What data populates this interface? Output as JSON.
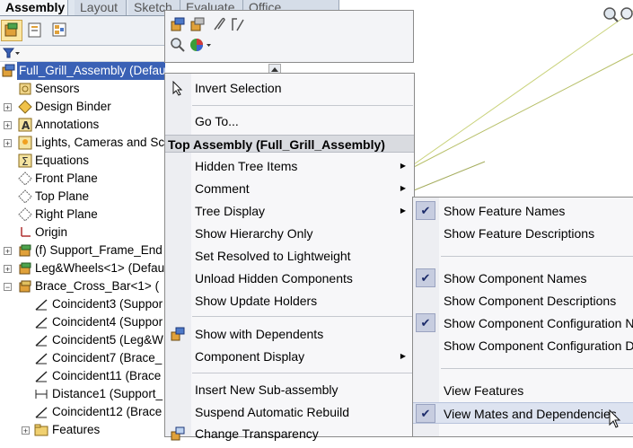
{
  "tabs": [
    "Assembly",
    "Layout",
    "Sketch",
    "Evaluate",
    "Office Products"
  ],
  "tree": {
    "root": "Full_Grill_Assembly  (Default<Full_Display_State",
    "items": [
      {
        "label": "Sensors",
        "icon": "sensors-icon",
        "expandable": false
      },
      {
        "label": "Design Binder",
        "icon": "design-binder-icon",
        "expandable": true
      },
      {
        "label": "Annotations",
        "icon": "annotations-icon",
        "expandable": true
      },
      {
        "label": "Lights, Cameras and Sc",
        "icon": "lights-cameras-icon",
        "expandable": true
      },
      {
        "label": "Equations",
        "icon": "equations-icon",
        "expandable": false
      },
      {
        "label": "Front Plane",
        "icon": "plane-icon",
        "expandable": false
      },
      {
        "label": "Top Plane",
        "icon": "plane-icon",
        "expandable": false
      },
      {
        "label": "Right Plane",
        "icon": "plane-icon",
        "expandable": false
      },
      {
        "label": "Origin",
        "icon": "origin-icon",
        "expandable": false
      },
      {
        "label": "(f) Support_Frame_End",
        "icon": "part-icon",
        "expandable": true
      },
      {
        "label": "Leg&Wheels<1>  (Defau",
        "icon": "subassembly-icon",
        "expandable": true
      },
      {
        "label": "Brace_Cross_Bar<1>  (",
        "icon": "part-icon",
        "expandable": true,
        "expanded": true
      }
    ],
    "mates": [
      {
        "label": "Coincident3  (Suppor",
        "icon": "coincident-mate-icon"
      },
      {
        "label": "Coincident4  (Suppor",
        "icon": "coincident-mate-icon"
      },
      {
        "label": "Coincident5  (Leg&W",
        "icon": "coincident-mate-icon"
      },
      {
        "label": "Coincident7  (Brace_",
        "icon": "coincident-mate-icon"
      },
      {
        "label": "Coincident11  (Brace",
        "icon": "coincident-mate-icon"
      },
      {
        "label": "Distance1  (Support_",
        "icon": "distance-mate-icon"
      },
      {
        "label": "Coincident12  (Brace",
        "icon": "coincident-mate-icon"
      }
    ],
    "features": "Features"
  },
  "context_menu": {
    "invert_selection": "Invert Selection",
    "go_to": "Go To...",
    "header": "Top Assembly (Full_Grill_Assembly)",
    "hidden_tree_items": "Hidden Tree Items",
    "comment": "Comment",
    "tree_display": "Tree Display",
    "show_hierarchy_only": "Show Hierarchy Only",
    "set_resolved": "Set Resolved to Lightweight",
    "unload_hidden": "Unload Hidden Components",
    "show_update_holders": "Show Update Holders",
    "show_with_dependents": "Show with Dependents",
    "component_display": "Component Display",
    "insert_subassembly": "Insert New Sub-assembly",
    "suspend_rebuild": "Suspend Automatic Rebuild",
    "change_transparency": "Change Transparency"
  },
  "submenu": {
    "show_feature_names": {
      "label": "Show Feature Names",
      "checked": true
    },
    "show_feature_descriptions": {
      "label": "Show Feature Descriptions",
      "checked": false
    },
    "show_component_names": {
      "label": "Show Component Names",
      "checked": true
    },
    "show_component_descriptions": {
      "label": "Show Component Descriptions",
      "checked": false
    },
    "show_component_config_names": {
      "label": "Show Component Configuration Na",
      "checked": true
    },
    "show_component_config_desc": {
      "label": "Show Component Configuration D",
      "checked": false
    },
    "view_features": {
      "label": "View Features",
      "checked": false
    },
    "view_mates": {
      "label": "View Mates and Dependencies",
      "checked": true
    }
  },
  "colors": {
    "selection": "#3a61b5",
    "menu_background": "#f7f7f9",
    "check_box": "#c7cde0"
  }
}
